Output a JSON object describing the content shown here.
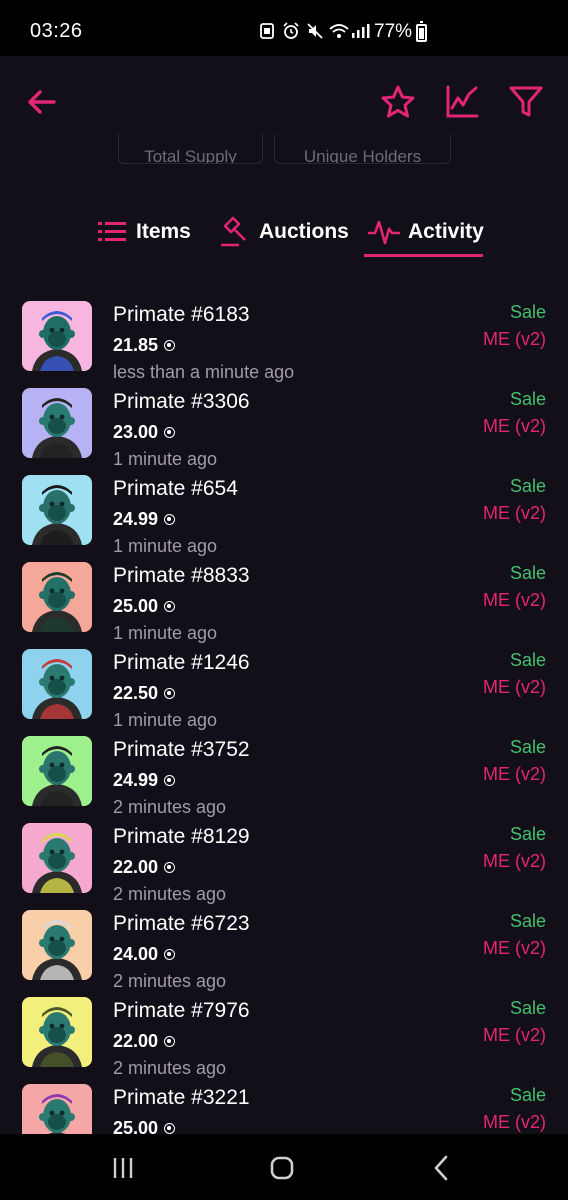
{
  "status_bar": {
    "time": "03:26",
    "battery": "77%"
  },
  "header": {
    "back_icon": "arrow-left-icon",
    "star_icon": "star-icon",
    "chart_icon": "line-chart-icon",
    "filter_icon": "filter-icon",
    "accent_color": "#e42575"
  },
  "stats": {
    "chip_1": "Total Supply",
    "chip_2": "Unique Holders"
  },
  "tabs": [
    {
      "label": "Items",
      "icon": "list-icon"
    },
    {
      "label": "Auctions",
      "icon": "gavel-icon"
    },
    {
      "label": "Activity",
      "icon": "activity-icon",
      "active": true
    }
  ],
  "activity": [
    {
      "name": "Primate #6183",
      "price": "21.85",
      "time": "less than a minute ago",
      "type": "Sale",
      "market": "ME (v2)",
      "bg": "#f7b6df",
      "head": "#1f6e66",
      "hat": "#3a5bd6"
    },
    {
      "name": "Primate #3306",
      "price": "23.00",
      "time": "1 minute ago",
      "type": "Sale",
      "market": "ME (v2)",
      "bg": "#b7b2f3",
      "head": "#2a7a72",
      "hat": "#222"
    },
    {
      "name": "Primate #654",
      "price": "24.99",
      "time": "1 minute ago",
      "type": "Sale",
      "market": "ME (v2)",
      "bg": "#9fe0f3",
      "head": "#2a6f6a",
      "hat": "#1a1a1a"
    },
    {
      "name": "Primate #8833",
      "price": "25.00",
      "time": "1 minute ago",
      "type": "Sale",
      "market": "ME (v2)",
      "bg": "#f5a79a",
      "head": "#227066",
      "hat": "#1b3d2e"
    },
    {
      "name": "Primate #1246",
      "price": "22.50",
      "time": "1 minute ago",
      "type": "Sale",
      "market": "ME (v2)",
      "bg": "#8fd2ee",
      "head": "#2a7a72",
      "hat": "#c43a3a"
    },
    {
      "name": "Primate #3752",
      "price": "24.99",
      "time": "2 minutes ago",
      "type": "Sale",
      "market": "ME (v2)",
      "bg": "#9ef08c",
      "head": "#2a756d",
      "hat": "#222"
    },
    {
      "name": "Primate #8129",
      "price": "22.00",
      "time": "2 minutes ago",
      "type": "Sale",
      "market": "ME (v2)",
      "bg": "#f5a9cf",
      "head": "#2a7a72",
      "hat": "#d8d84a"
    },
    {
      "name": "Primate #6723",
      "price": "24.00",
      "time": "2 minutes ago",
      "type": "Sale",
      "market": "ME (v2)",
      "bg": "#f8cfa8",
      "head": "#2a7a72",
      "hat": "#d8d8d8"
    },
    {
      "name": "Primate #7976",
      "price": "22.00",
      "time": "2 minutes ago",
      "type": "Sale",
      "market": "ME (v2)",
      "bg": "#f3ef7c",
      "head": "#2a7a72",
      "hat": "#4a5a2a"
    },
    {
      "name": "Primate #3221",
      "price": "25.00",
      "time": "",
      "type": "Sale",
      "market": "ME (v2)",
      "bg": "#f5a7a7",
      "head": "#2a7a72",
      "hat": "#8a3ab0"
    }
  ],
  "nav": {
    "recent_icon": "recent-apps-icon",
    "home_icon": "home-icon",
    "back_icon": "nav-back-icon"
  }
}
